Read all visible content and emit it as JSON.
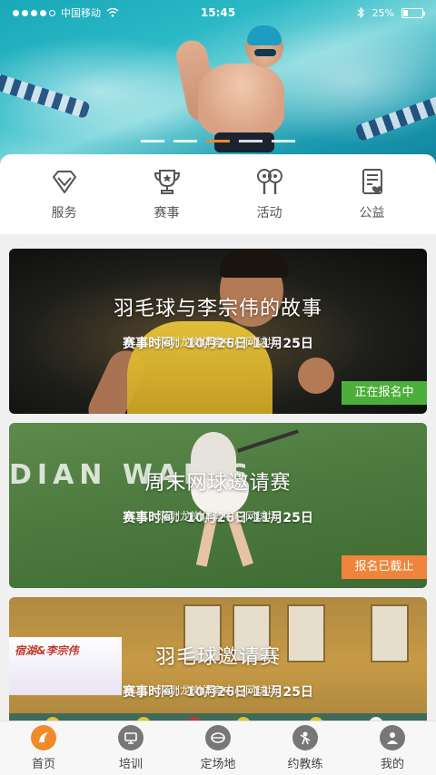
{
  "status_bar": {
    "carrier": "中国移动",
    "time": "15:45",
    "battery": "25%",
    "battery_level": 0.25
  },
  "banner": {
    "slide_count": 5,
    "active_slide": 3
  },
  "categories": [
    {
      "label": "服务",
      "icon": "diamond-icon"
    },
    {
      "label": "赛事",
      "icon": "trophy-icon"
    },
    {
      "label": "活动",
      "icon": "rackets-icon"
    },
    {
      "label": "公益",
      "icon": "clipboard-heart-icon"
    }
  ],
  "events": [
    {
      "title": "羽毛球与李宗伟的故事",
      "time": "赛事时间：10月26日-11月25日",
      "venue": "深圳龙岗体育中心网球场",
      "status": "正在报名中",
      "status_color": "#4caf3a"
    },
    {
      "title": "周末网球邀请赛",
      "time": "赛事时间：10月26日-11月25日",
      "venue": "深圳龙岗体育中心网球场",
      "status": "报名已截止",
      "status_color": "#f0843a"
    },
    {
      "title": "羽毛球邀请赛",
      "time": "赛事时间：10月26日-11月25日",
      "venue": "深圳龙岗体育中心网球场"
    }
  ],
  "card_backgrounds": {
    "tennis_wall_text": "DIAN WALLS",
    "gym_banner_text": "宿湖&李宗伟"
  },
  "tabbar": [
    {
      "label": "首页",
      "icon": "home-icon",
      "active": true
    },
    {
      "label": "培训",
      "icon": "training-icon",
      "active": false
    },
    {
      "label": "定场地",
      "icon": "court-booking-icon",
      "active": false
    },
    {
      "label": "约教练",
      "icon": "coach-icon",
      "active": false
    },
    {
      "label": "我的",
      "icon": "profile-icon",
      "active": false
    }
  ],
  "colors": {
    "accent": "#f08a2a",
    "open_badge": "#4caf3a",
    "closed_badge": "#f0843a"
  }
}
